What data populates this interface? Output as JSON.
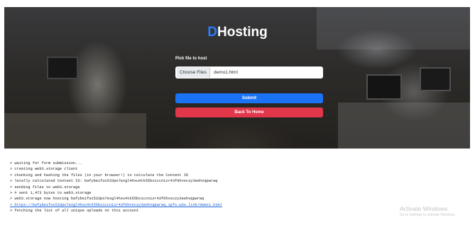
{
  "brand": {
    "prefix": "D",
    "rest": "Hosting"
  },
  "form": {
    "pick_label": "Pick file to host",
    "choose_files_label": "Choose Files",
    "file_name": "demo1.html",
    "submit_label": "Submit",
    "back_label": "Back To Home"
  },
  "log": [
    "> waiting for form submission...",
    "> creating web3.storage client",
    "> chunking and hashing the files (in your browser!) to calculate the Content ID",
    "> locally calculated Content ID: bafybeifux533po7exgl4hxu4tk55bxiccnizr43f6hvsczy3eehvqpwrwq",
    "> sending files to web3.storage",
    "> # sent 1,473 bytes to web3.storage",
    "> web3.storage now hosting bafybeifux533po7exgl4hxu4tk55bxiccnizr43f6hvsczy3eehvqpwrwq",
    "> https://bafybeifux533po7exgl4hxu4tk55bxiccnizr43f6hvsczy3eehvqpwrwq.ipfs.w3s.link/demo1.html",
    "> fetching the list of all unique uploads on this account"
  ],
  "watermark": {
    "title": "Activate Windows",
    "subtitle": "Go to Settings to activate Windows."
  },
  "colors": {
    "brand_accent": "#2b7cff",
    "submit": "#1a73f5",
    "back": "#e2364a",
    "link": "#1a5fd6"
  }
}
